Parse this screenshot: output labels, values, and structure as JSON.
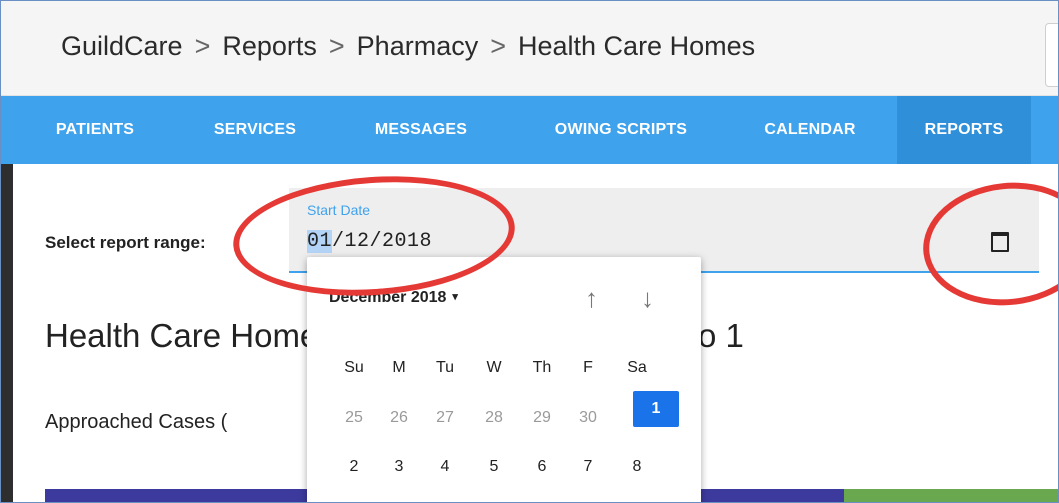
{
  "breadcrumb": [
    "GuildCare",
    "Reports",
    "Pharmacy",
    "Health Care Homes"
  ],
  "breadcrumb_separator": ">",
  "nav": {
    "items": [
      "PATIENTS",
      "SERVICES",
      "MESSAGES",
      "OWING SCRIPTS",
      "CALENDAR",
      "REPORTS"
    ],
    "active": "REPORTS"
  },
  "report_range": {
    "label": "Select report range:",
    "start_date_label": "Start Date",
    "start_date_selected": "01",
    "start_date_rest": "/12/2018",
    "calendar_icon": "calendar-icon"
  },
  "heading": "Health Care Homes report from 01/12/2018 to 1",
  "approached_label": "Approached Cases (",
  "date_picker": {
    "month": "December 2018",
    "caret": "▾",
    "prev_icon": "arrow-up-icon",
    "next_icon": "arrow-down-icon",
    "up_glyph": "↑",
    "down_glyph": "↓",
    "weekdays": [
      "Su",
      "M",
      "Tu",
      "W",
      "Th",
      "F",
      "Sa"
    ],
    "weeks": [
      [
        "25",
        "26",
        "27",
        "28",
        "29",
        "30",
        "1"
      ],
      [
        "2",
        "3",
        "4",
        "5",
        "6",
        "7",
        "8"
      ]
    ],
    "selected_day": "1"
  },
  "colors": {
    "nav_bg": "#3fa2ec",
    "nav_active": "#2f8fd9",
    "selected_day": "#1a73e8",
    "annotation_red": "#e53935",
    "bar_purple": "#3d3a9e",
    "bar_green": "#6aa84f"
  }
}
